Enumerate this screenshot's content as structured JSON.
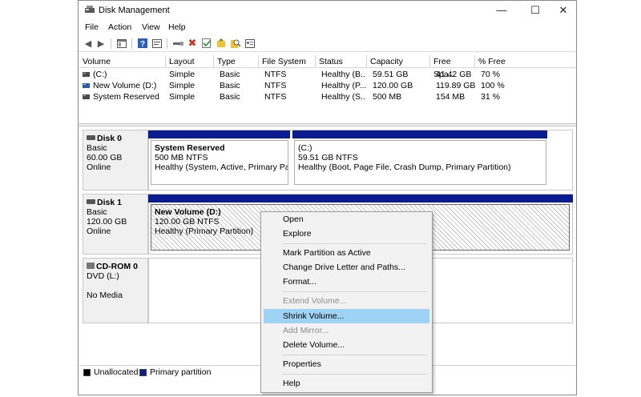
{
  "window": {
    "title": "Disk Management",
    "minimize_glyph": "—",
    "maximize_glyph": "☐",
    "close_glyph": "✕"
  },
  "menubar": {
    "items": [
      {
        "label": "File"
      },
      {
        "label": "Action"
      },
      {
        "label": "View"
      },
      {
        "label": "Help"
      }
    ]
  },
  "toolbar": {
    "icons": [
      "back-arrow-icon",
      "forward-arrow-icon",
      "console-tree-icon",
      "help-icon",
      "properties-icon",
      "connect-drive-icon",
      "delete-icon",
      "checkmark-icon",
      "import-disk-icon",
      "search-icon",
      "settings-panel-icon"
    ]
  },
  "volumes": {
    "columns": [
      "Volume",
      "Layout",
      "Type",
      "File System",
      "Status",
      "Capacity",
      "Free Spa...",
      "% Free"
    ],
    "rows": [
      {
        "volume": "(C:)",
        "layout": "Simple",
        "type": "Basic",
        "fs": "NTFS",
        "status": "Healthy (B...",
        "capacity": "59.51 GB",
        "free": "41.42 GB",
        "pct": "70 %"
      },
      {
        "volume": "New Volume (D:)",
        "layout": "Simple",
        "type": "Basic",
        "fs": "NTFS",
        "status": "Healthy (P...",
        "capacity": "120.00 GB",
        "free": "119.89 GB",
        "pct": "100 %"
      },
      {
        "volume": "System Reserved",
        "layout": "Simple",
        "type": "Basic",
        "fs": "NTFS",
        "status": "Healthy (S...",
        "capacity": "500 MB",
        "free": "154 MB",
        "pct": "31 %"
      }
    ]
  },
  "disks": [
    {
      "name": "Disk 0",
      "type": "Basic",
      "size": "60.00 GB",
      "state": "Online",
      "partitions": [
        {
          "name": "System Reserved",
          "size_fs": "500 MB NTFS",
          "status": "Healthy (System, Active, Primary Partit"
        },
        {
          "name": "(C:)",
          "size_fs": "59.51 GB NTFS",
          "status": "Healthy (Boot, Page File, Crash Dump, Primary Partition)"
        }
      ]
    },
    {
      "name": "Disk 1",
      "type": "Basic",
      "size": "120.00 GB",
      "state": "Online",
      "partitions": [
        {
          "name": "New Volume  (D:)",
          "size_fs": "120.00 GB NTFS",
          "status": "Healthy (Primary Partition)"
        }
      ]
    },
    {
      "name": "CD-ROM 0",
      "type": "DVD (L:)",
      "size": "",
      "state": "No Media",
      "partitions": []
    }
  ],
  "legend": {
    "items": [
      {
        "label": "Unallocated",
        "color": "#000000"
      },
      {
        "label": "Primary partition",
        "color": "#0b1b92"
      }
    ]
  },
  "context_menu": {
    "items": [
      {
        "label": "Open",
        "enabled": true
      },
      {
        "label": "Explore",
        "enabled": true
      },
      {
        "label": "Mark Partition as Active",
        "enabled": true
      },
      {
        "label": "Change Drive Letter and Paths...",
        "enabled": true
      },
      {
        "label": "Format...",
        "enabled": true
      },
      {
        "label": "Extend Volume...",
        "enabled": false
      },
      {
        "label": "Shrink Volume...",
        "enabled": true,
        "highlighted": true
      },
      {
        "label": "Add Mirror...",
        "enabled": false
      },
      {
        "label": "Delete Volume...",
        "enabled": true
      },
      {
        "label": "Properties",
        "enabled": true
      },
      {
        "label": "Help",
        "enabled": true
      }
    ]
  },
  "colors": {
    "primary_partition": "#0b1b92",
    "highlight": "#9fd3f5"
  }
}
